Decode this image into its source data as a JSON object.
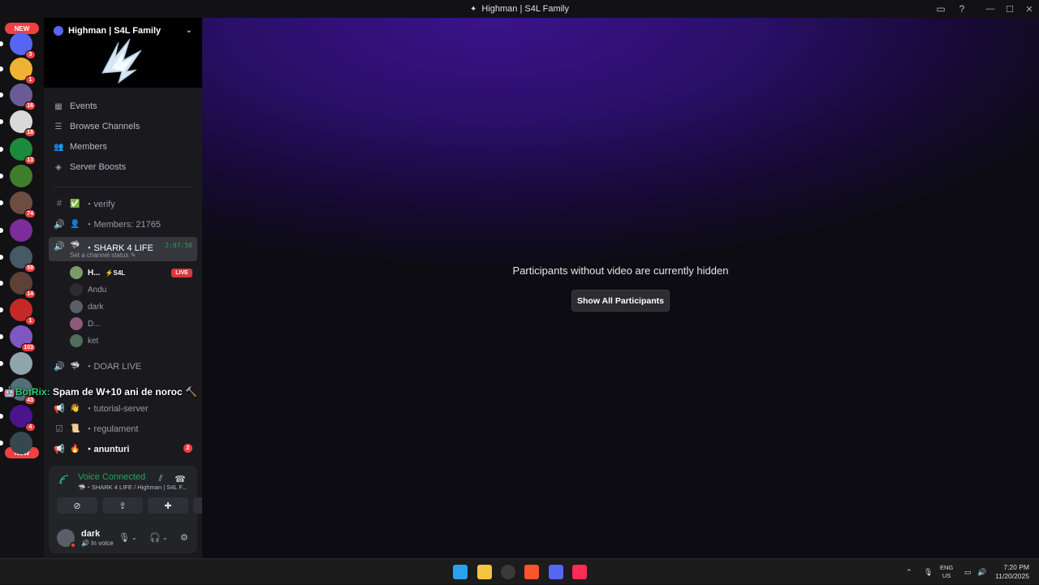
{
  "window": {
    "title": "Highman | S4L Family",
    "new_label": "NEW"
  },
  "guilds": [
    {
      "badge": "3",
      "color": "#5865f2"
    },
    {
      "badge": "1",
      "color": "#f0b232"
    },
    {
      "badge": "16",
      "color": "#6b5b95"
    },
    {
      "badge": "18",
      "color": "#d9d9d9"
    },
    {
      "badge": "13",
      "color": "#1b8a3c"
    },
    {
      "badge": "",
      "color": "#3e7d2a"
    },
    {
      "badge": "74",
      "color": "#6d4c41"
    },
    {
      "badge": "",
      "color": "#7b2d9b"
    },
    {
      "badge": "59",
      "color": "#455a64"
    },
    {
      "badge": "14",
      "color": "#5d4037"
    },
    {
      "badge": "1",
      "color": "#c62828"
    },
    {
      "badge": "103",
      "color": "#7e57c2"
    },
    {
      "badge": "",
      "color": "#90a4ae"
    },
    {
      "badge": "43",
      "color": "#546e7a"
    },
    {
      "badge": "4",
      "color": "#4a148c"
    },
    {
      "badge": "",
      "color": "#37474f"
    }
  ],
  "server": {
    "name": "Highman | S4L Family",
    "nav": [
      {
        "label": "Events",
        "icon": "calendar-icon",
        "glyph": "▦"
      },
      {
        "label": "Browse Channels",
        "icon": "list-icon",
        "glyph": "☰"
      },
      {
        "label": "Members",
        "icon": "members-icon",
        "glyph": "👥"
      },
      {
        "label": "Server Boosts",
        "icon": "boost-icon",
        "glyph": "◈"
      }
    ]
  },
  "channels": {
    "verify": {
      "icon": "hash-icon",
      "glyph": "#",
      "emoji": "✅",
      "label": "・verify"
    },
    "members": {
      "icon": "speaker-icon",
      "glyph": "🔊",
      "emoji": "👤",
      "label": "・Members: 21765"
    },
    "shark": {
      "icon": "speaker-icon",
      "glyph": "🔊",
      "emoji": "🦈",
      "label": "・SHARK 4 LIFE",
      "timer": "2:07:50",
      "status": "Set a channel status ✎"
    },
    "doar_live": {
      "icon": "speaker-icon",
      "glyph": "🔊",
      "emoji": "🦈",
      "label": "・DOAR LIVE"
    },
    "tutorial": {
      "icon": "announce-icon",
      "glyph": "📢",
      "emoji": "👋",
      "label": "・tutorial-server"
    },
    "regulament": {
      "icon": "rules-icon",
      "glyph": "☑",
      "emoji": "📜",
      "label": "・regulament"
    },
    "anunturi": {
      "icon": "announce-icon",
      "glyph": "📢",
      "emoji": "🔥",
      "label": "・anunturi",
      "unread": "2"
    }
  },
  "voice_members": [
    {
      "name": "H...",
      "tag": "⚡S4L",
      "live": "LIVE",
      "color": "#7a9a6a"
    },
    {
      "name": "Andu",
      "tag": "",
      "live": "",
      "color": "#2b2d31"
    },
    {
      "name": "dark",
      "tag": "",
      "live": "",
      "color": "#5a5e66"
    },
    {
      "name": "D...",
      "tag": "",
      "live": "",
      "color": "#8e5a7a"
    },
    {
      "name": "ket",
      "tag": "",
      "live": "",
      "color": "#4f6d5a"
    }
  ],
  "overlay": {
    "bot": "🤖BotRix:",
    "text": " Spam de W+10 ani de noroc 🔨"
  },
  "voice_panel": {
    "title": "Voice Connected",
    "subtitle": "🦈・SHARK 4 LIFE / Highman | S4L F...",
    "buttons": [
      {
        "name": "camera-off-button",
        "glyph": "⊘"
      },
      {
        "name": "screen-share-button",
        "glyph": "⇪"
      },
      {
        "name": "activities-button",
        "glyph": "✚"
      },
      {
        "name": "soundboard-button",
        "glyph": "✦"
      }
    ]
  },
  "user": {
    "name": "dark",
    "status": "🔊 In voice"
  },
  "stage": {
    "message": "Participants without video are currently hidden",
    "button": "Show All Participants"
  },
  "taskbar": {
    "lang_top": "ENG",
    "lang_bottom": "US",
    "time": "7:20 PM",
    "date": "11/20/2025",
    "apps": [
      {
        "name": "start-icon",
        "color": "#2aa0f0"
      },
      {
        "name": "file-explorer-icon",
        "color": "#f4c542"
      },
      {
        "name": "obs-icon",
        "color": "#3a3a3a"
      },
      {
        "name": "brave-icon",
        "color": "#fb542b"
      },
      {
        "name": "discord-icon",
        "color": "#5865f2"
      },
      {
        "name": "tiktok-icon",
        "color": "#ff2c55"
      }
    ]
  }
}
